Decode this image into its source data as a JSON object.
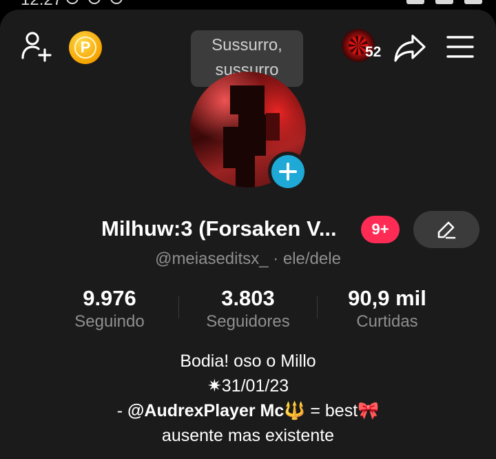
{
  "status_bar": {
    "time": "12:27"
  },
  "header": {
    "add_friend_icon": "person-add-icon",
    "coin_label": "P",
    "whisper_line1": "Sussurro,",
    "whisper_line2": "sussurro",
    "visitor_count": "52",
    "share_icon": "share-arrow-icon",
    "menu_icon": "hamburger-menu-icon"
  },
  "profile": {
    "name": "Milhuw:3 (Forsaken V...",
    "badge": "9+",
    "handle": "@meiaseditsx_",
    "pronouns": "· ele/dele"
  },
  "stats": [
    {
      "value": "9.976",
      "label": "Seguindo"
    },
    {
      "value": "3.803",
      "label": "Seguidores"
    },
    {
      "value": "90,9 mil",
      "label": "Curtidas"
    }
  ],
  "bio": {
    "line1": "Bodia! oso o Millo",
    "line2": "✷31/01/23",
    "line3_prefix": "- ",
    "line3_mention": "@AudrexPlayer Mc🔱",
    "line3_suffix": " = best🎀",
    "line4": "ausente mas existente"
  },
  "colors": {
    "background": "#1b1b1b",
    "badge": "#fe2c55",
    "add_avatar": "#1fa9d6",
    "coin": "#f5a300",
    "muted_text": "#8f8f8f"
  }
}
